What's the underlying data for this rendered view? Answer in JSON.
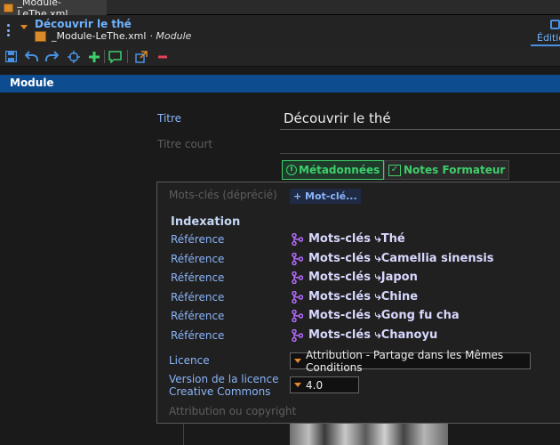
{
  "file_tab": {
    "label": "_Module-LeThe.xml"
  },
  "document": {
    "title": "Découvrir le thé",
    "file_name": "_Module-LeThe.xml",
    "kind": "· Module"
  },
  "edition_tab": {
    "label": "Éditio"
  },
  "toolbar": {
    "buttons": [
      "save-icon",
      "undo-icon",
      "redo-icon",
      "target-icon",
      "add-icon",
      "comment-icon",
      "open-external-icon",
      "remove-icon"
    ]
  },
  "section": {
    "title": "Module"
  },
  "fields": {
    "titre_label": "Titre",
    "titre_value": "Découvrir le thé",
    "titre_court_label": "Titre court"
  },
  "tags": {
    "metadata": "Métadonnées",
    "notes": "Notes Formateur"
  },
  "metadata": {
    "keywords_label": "Mots-clés (déprécié)",
    "keywords_add": "+ Mot-clé...",
    "indexation_title": "Indexation",
    "references": [
      {
        "label": "Référence",
        "value": "Mots-clés ⤷Thé"
      },
      {
        "label": "Référence",
        "value": "Mots-clés ⤷Camellia sinensis"
      },
      {
        "label": "Référence",
        "value": "Mots-clés ⤷Japon"
      },
      {
        "label": "Référence",
        "value": "Mots-clés ⤷Chine"
      },
      {
        "label": "Référence",
        "value": "Mots-clés ⤷Gong fu cha"
      },
      {
        "label": "Référence",
        "value": "Mots-clés ⤷Chanoyu"
      }
    ],
    "licence_label": "Licence",
    "licence_value": "Attribution - Partage dans les Mêmes Conditions",
    "cc_version_label_1": "Version de la licence",
    "cc_version_label_2": "Creative Commons",
    "cc_version_value": "4.0",
    "attribution_label": "Attribution ou copyright"
  },
  "colors": {
    "accent_blue": "#0d4c8f",
    "link_blue": "#8ab4f8",
    "green": "#3ecf6b",
    "orange": "#e08a2a",
    "purple": "#b56bff"
  }
}
